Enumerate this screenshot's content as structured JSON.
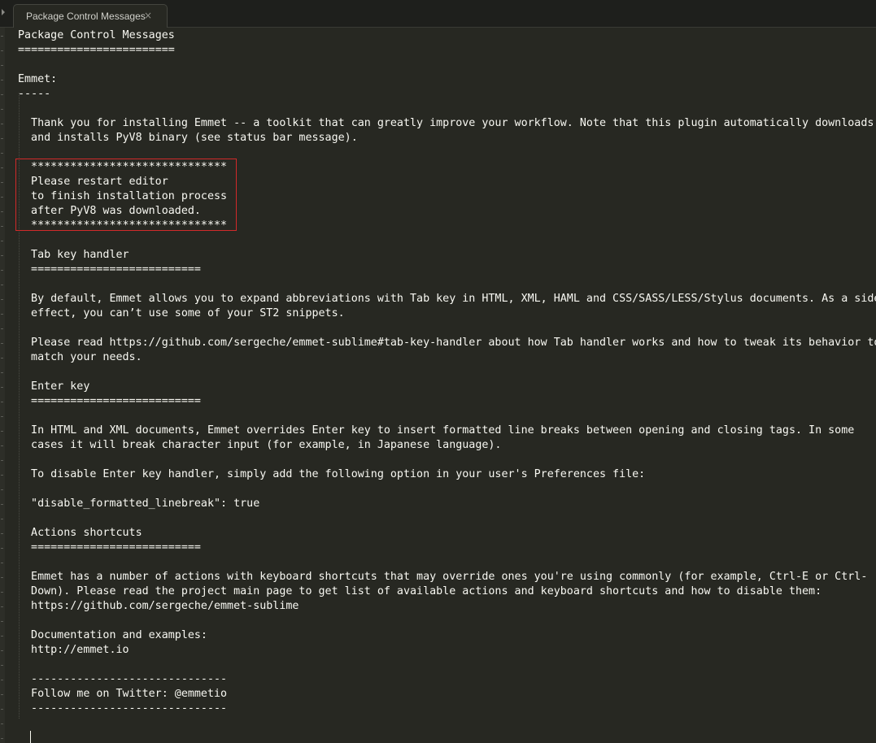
{
  "tab": {
    "title": "Package Control Messages",
    "close_glyph": "×"
  },
  "document": {
    "lines": [
      {
        "text": "Package Control Messages",
        "indent": 0
      },
      {
        "text": "========================",
        "indent": 0
      },
      {
        "text": "",
        "indent": 0
      },
      {
        "text": "Emmet:",
        "indent": 0
      },
      {
        "text": "-----",
        "indent": 0
      },
      {
        "text": "",
        "indent": 0
      },
      {
        "text": "Thank you for installing Emmet -- a toolkit that can greatly improve your workflow. Note that this plugin automatically downloads",
        "indent": 2
      },
      {
        "text": "and installs PyV8 binary (see status bar message).",
        "indent": 2
      },
      {
        "text": "",
        "indent": 0
      },
      {
        "text": "******************************",
        "indent": 2
      },
      {
        "text": "Please restart editor",
        "indent": 2
      },
      {
        "text": "to finish installation process",
        "indent": 2
      },
      {
        "text": "after PyV8 was downloaded.",
        "indent": 2
      },
      {
        "text": "******************************",
        "indent": 2
      },
      {
        "text": "",
        "indent": 0
      },
      {
        "text": "Tab key handler",
        "indent": 2
      },
      {
        "text": "==========================",
        "indent": 2
      },
      {
        "text": "",
        "indent": 0
      },
      {
        "text": "By default, Emmet allows you to expand abbreviations with Tab key in HTML, XML, HAML and CSS/SASS/LESS/Stylus documents. As a side",
        "indent": 2
      },
      {
        "text": "effect, you can’t use some of your ST2 snippets.",
        "indent": 2
      },
      {
        "text": "",
        "indent": 0
      },
      {
        "text": "Please read https://github.com/sergeche/emmet-sublime#tab-key-handler about how Tab handler works and how to tweak its behavior to",
        "indent": 2
      },
      {
        "text": "match your needs.",
        "indent": 2
      },
      {
        "text": "",
        "indent": 0
      },
      {
        "text": "Enter key",
        "indent": 2
      },
      {
        "text": "==========================",
        "indent": 2
      },
      {
        "text": "",
        "indent": 0
      },
      {
        "text": "In HTML and XML documents, Emmet overrides Enter key to insert formatted line breaks between opening and closing tags. In some",
        "indent": 2
      },
      {
        "text": "cases it will break character input (for example, in Japanese language).",
        "indent": 2
      },
      {
        "text": "",
        "indent": 0
      },
      {
        "text": "To disable Enter key handler, simply add the following option in your user's Preferences file:",
        "indent": 2
      },
      {
        "text": "",
        "indent": 0
      },
      {
        "text": "\"disable_formatted_linebreak\": true",
        "indent": 2
      },
      {
        "text": "",
        "indent": 0
      },
      {
        "text": "Actions shortcuts",
        "indent": 2
      },
      {
        "text": "==========================",
        "indent": 2
      },
      {
        "text": "",
        "indent": 0
      },
      {
        "text": "Emmet has a number of actions with keyboard shortcuts that may override ones you're using commonly (for example, Ctrl-E or Ctrl-",
        "indent": 2
      },
      {
        "text": "Down). Please read the project main page to get list of available actions and keyboard shortcuts and how to disable them:",
        "indent": 2
      },
      {
        "text": "https://github.com/sergeche/emmet-sublime",
        "indent": 2
      },
      {
        "text": "",
        "indent": 0
      },
      {
        "text": "Documentation and examples:",
        "indent": 2
      },
      {
        "text": "http://emmet.io",
        "indent": 2
      },
      {
        "text": "",
        "indent": 0
      },
      {
        "text": "------------------------------",
        "indent": 2
      },
      {
        "text": "Follow me on Twitter: @emmetio",
        "indent": 2
      },
      {
        "text": "------------------------------",
        "indent": 2
      },
      {
        "text": "",
        "indent": 0
      },
      {
        "text": "",
        "indent": 0
      }
    ]
  },
  "colors": {
    "background": "#272822",
    "foreground": "#f8f8f2",
    "highlight_border": "#d12a2a"
  }
}
